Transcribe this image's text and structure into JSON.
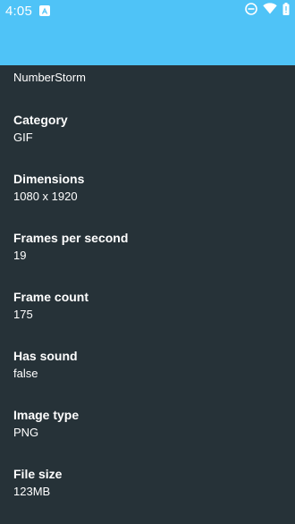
{
  "status_bar": {
    "time": "4:05",
    "icons": [
      "notification-a-icon",
      "do-not-disturb-icon",
      "wifi-icon",
      "battery-icon"
    ]
  },
  "colors": {
    "accent": "#4fc3f7",
    "background": "#263238",
    "text": "#ffffff"
  },
  "details": {
    "title_value": "NumberStorm",
    "properties": [
      {
        "label": "Category",
        "value": "GIF"
      },
      {
        "label": "Dimensions",
        "value": "1080 x 1920"
      },
      {
        "label": "Frames per second",
        "value": "19"
      },
      {
        "label": "Frame count",
        "value": "175"
      },
      {
        "label": "Has sound",
        "value": "false"
      },
      {
        "label": "Image type",
        "value": "PNG"
      },
      {
        "label": "File size",
        "value": "123MB"
      }
    ]
  }
}
